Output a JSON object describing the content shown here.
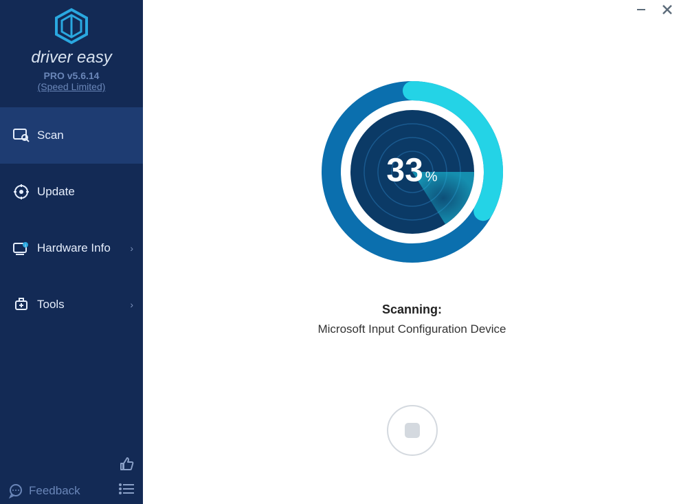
{
  "brand": {
    "name": "driver easy",
    "version": "PRO v5.6.14",
    "speed_note": "(Speed Limited)"
  },
  "nav": {
    "scan": "Scan",
    "update": "Update",
    "hardware": "Hardware Info",
    "tools": "Tools"
  },
  "feedback_label": "Feedback",
  "scan": {
    "percent": "33",
    "percent_symbol": "%",
    "status_label": "Scanning:",
    "current_device": "Microsoft Input Configuration Device"
  },
  "colors": {
    "ring_outer": "#0b6fae",
    "ring_inner": "#0b3a66",
    "ring_progress": "#24d3e6",
    "sweep": "#1cc7e0"
  }
}
